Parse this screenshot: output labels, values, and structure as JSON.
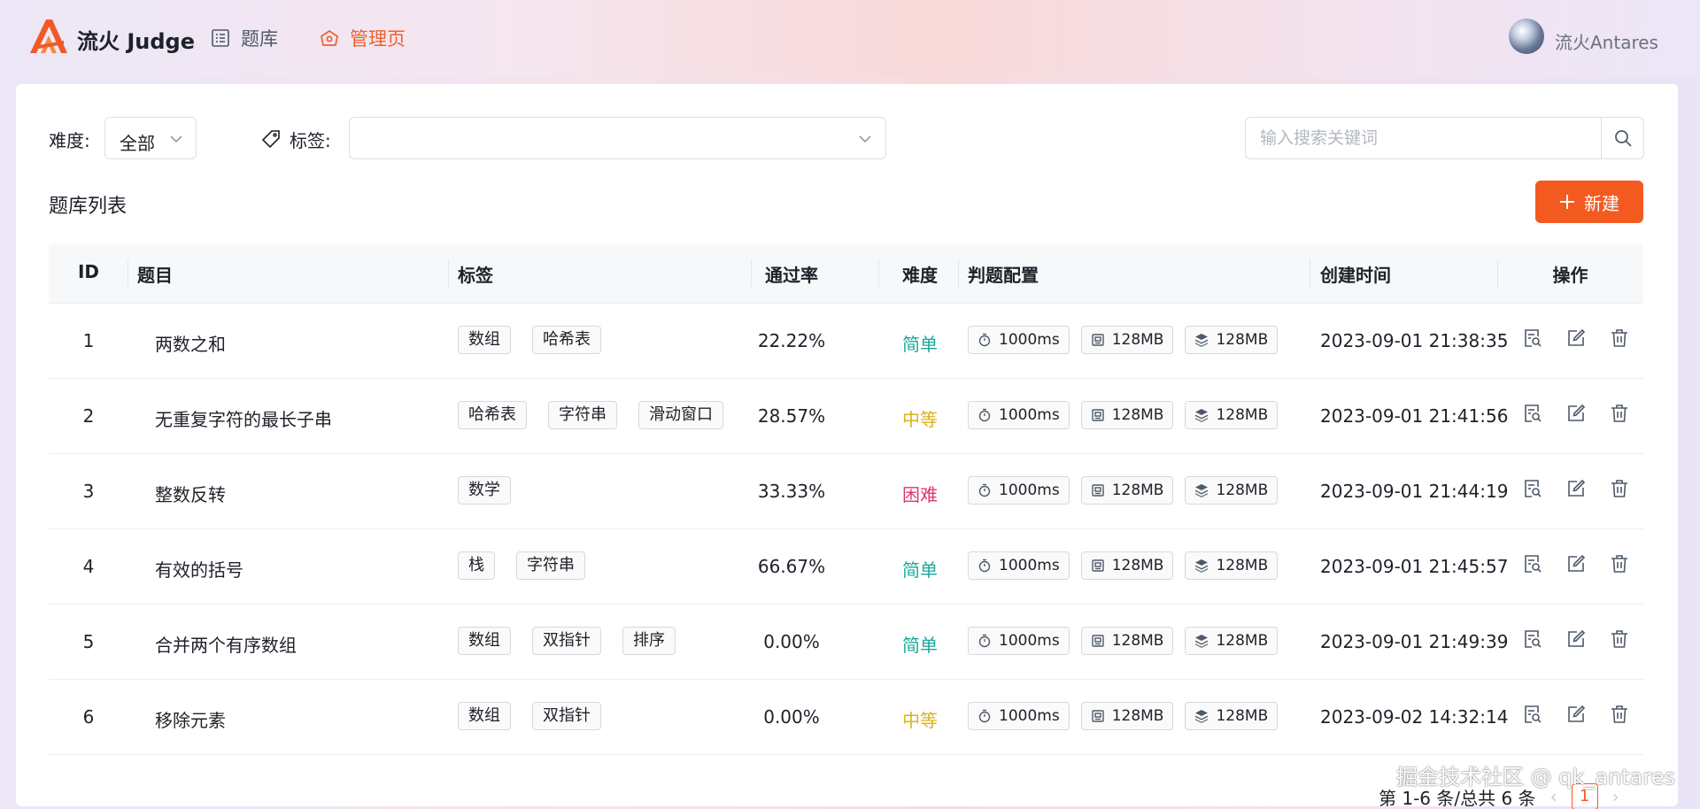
{
  "colors": {
    "accent": "#f35a1f",
    "easy": "#1aa89a",
    "medium": "#d9b21b",
    "hard": "#e0366e"
  },
  "header": {
    "brand": "流火 Judge",
    "nav": [
      {
        "label": "题库",
        "icon": "list-icon"
      },
      {
        "label": "管理页",
        "icon": "admin-home-icon",
        "active": true
      }
    ],
    "user": {
      "name": "流火Antares",
      "avatar": "avatar"
    }
  },
  "filters": {
    "difficulty_label": "难度:",
    "difficulty_value": "全部",
    "tags_label": "标签:",
    "tags_value": "",
    "search_placeholder": "输入搜索关键词"
  },
  "list": {
    "title": "题库列表",
    "new_button": "新建"
  },
  "table": {
    "columns": [
      "ID",
      "题目",
      "标签",
      "通过率",
      "难度",
      "判题配置",
      "创建时间",
      "操作"
    ],
    "rows": [
      {
        "id": "1",
        "title": "两数之和",
        "tags": [
          "数组",
          "哈希表"
        ],
        "rate": "22.22%",
        "difficulty": "简单",
        "level": "easy",
        "time_limit": "1000ms",
        "memory": "128MB",
        "stack": "128MB",
        "created": "2023-09-01 21:38:35"
      },
      {
        "id": "2",
        "title": "无重复字符的最长子串",
        "tags": [
          "哈希表",
          "字符串",
          "滑动窗口"
        ],
        "rate": "28.57%",
        "difficulty": "中等",
        "level": "medium",
        "time_limit": "1000ms",
        "memory": "128MB",
        "stack": "128MB",
        "created": "2023-09-01 21:41:56"
      },
      {
        "id": "3",
        "title": "整数反转",
        "tags": [
          "数学"
        ],
        "rate": "33.33%",
        "difficulty": "困难",
        "level": "hard",
        "time_limit": "1000ms",
        "memory": "128MB",
        "stack": "128MB",
        "created": "2023-09-01 21:44:19"
      },
      {
        "id": "4",
        "title": "有效的括号",
        "tags": [
          "栈",
          "字符串"
        ],
        "rate": "66.67%",
        "difficulty": "简单",
        "level": "easy",
        "time_limit": "1000ms",
        "memory": "128MB",
        "stack": "128MB",
        "created": "2023-09-01 21:45:57"
      },
      {
        "id": "5",
        "title": "合并两个有序数组",
        "tags": [
          "数组",
          "双指针",
          "排序"
        ],
        "rate": "0.00%",
        "difficulty": "简单",
        "level": "easy",
        "time_limit": "1000ms",
        "memory": "128MB",
        "stack": "128MB",
        "created": "2023-09-01 21:49:39"
      },
      {
        "id": "6",
        "title": "移除元素",
        "tags": [
          "数组",
          "双指针"
        ],
        "rate": "0.00%",
        "difficulty": "中等",
        "level": "medium",
        "time_limit": "1000ms",
        "memory": "128MB",
        "stack": "128MB",
        "created": "2023-09-02 14:32:14"
      }
    ]
  },
  "pagination": {
    "summary": "第 1-6 条/总共 6 条",
    "current": "1"
  },
  "watermark": "掘金技术社区 @ qk_antares"
}
